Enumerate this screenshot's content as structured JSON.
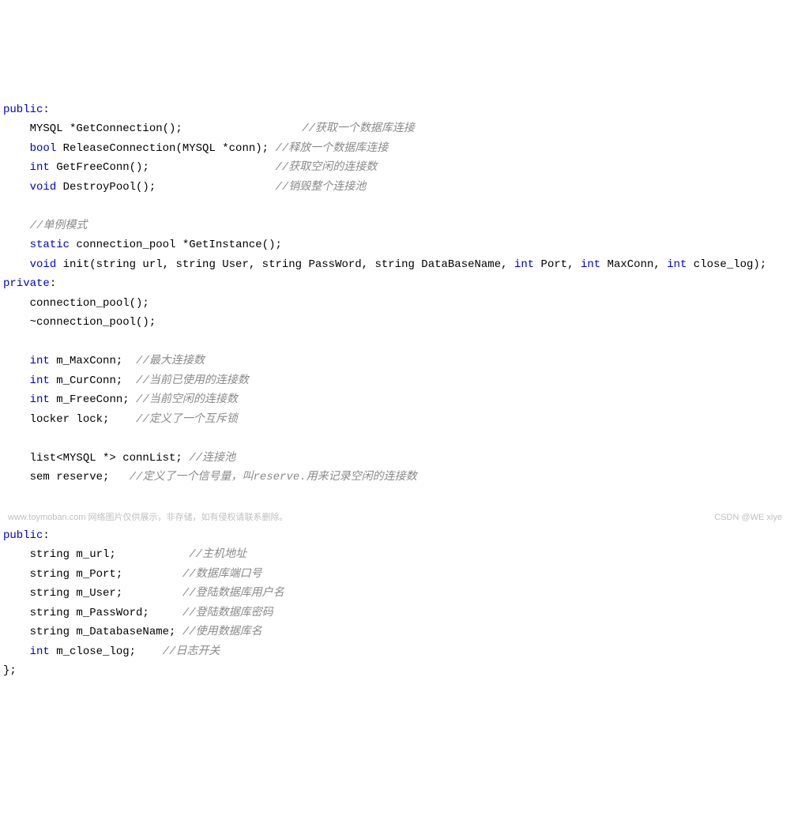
{
  "code": {
    "l1": {
      "kw": "public",
      "rest": ":"
    },
    "l2": {
      "indent": "    MYSQL *GetConnection();                  ",
      "comment": "//获取一个数据库连接"
    },
    "l3": {
      "indent": "    ",
      "kw": "bool",
      "rest": " ReleaseConnection(MYSQL *conn); ",
      "comment": "//释放一个数据库连接"
    },
    "l4": {
      "indent": "    ",
      "kw": "int",
      "rest": " GetFreeConn();                   ",
      "comment": "//获取空闲的连接数"
    },
    "l5": {
      "indent": "    ",
      "kw": "void",
      "rest": " DestroyPool();                  ",
      "comment": "//销毁整个连接池"
    },
    "blank1": "",
    "l6": {
      "indent": "    ",
      "comment": "//单例模式"
    },
    "l7": {
      "indent": "    ",
      "kw": "static",
      "rest": " connection_pool *GetInstance();"
    },
    "l8": {
      "indent": "    ",
      "kw1": "void",
      "mid": " init(string url, string User, string PassWord, string DataBaseName, ",
      "kw2": "int",
      "mid2": " Port, ",
      "kw3": "int",
      "mid3": " MaxConn, ",
      "kw4": "int",
      "rest": " close_log);"
    },
    "l9": {
      "kw": "private",
      "rest": ":"
    },
    "l10": {
      "indent": "    connection_pool();"
    },
    "l11": {
      "indent": "    ~connection_pool();"
    },
    "blank2": "",
    "l12": {
      "indent": "    ",
      "kw": "int",
      "rest": " m_MaxConn;  ",
      "comment": "//最大连接数"
    },
    "l13": {
      "indent": "    ",
      "kw": "int",
      "rest": " m_CurConn;  ",
      "comment": "//当前已使用的连接数"
    },
    "l14": {
      "indent": "    ",
      "kw": "int",
      "rest": " m_FreeConn; ",
      "comment": "//当前空闲的连接数"
    },
    "l15": {
      "indent": "    locker lock;    ",
      "comment": "//定义了一个互斥锁"
    },
    "blank3": "",
    "l16": {
      "indent": "    list<MYSQL *> connList; ",
      "comment": "//连接池"
    },
    "l17": {
      "indent": "    sem reserve;   ",
      "comment": "//定义了一个信号量，叫reserve.用来记录空闲的连接数"
    },
    "blank4": "",
    "blank5": "",
    "l18": {
      "kw": "public",
      "rest": ":"
    },
    "l19": {
      "indent": "    string m_url;           ",
      "comment": "//主机地址"
    },
    "l20": {
      "indent": "    string m_Port;         ",
      "comment": "//数据库端口号"
    },
    "l21": {
      "indent": "    string m_User;         ",
      "comment": "//登陆数据库用户名"
    },
    "l22": {
      "indent": "    string m_PassWord;     ",
      "comment": "//登陆数据库密码"
    },
    "l23": {
      "indent": "    string m_DatabaseName; ",
      "comment": "//使用数据库名"
    },
    "l24": {
      "indent": "    ",
      "kw": "int",
      "rest": " m_close_log;    ",
      "comment": "//日志开关"
    },
    "l25": {
      "text": "};"
    }
  },
  "watermarks": {
    "left": "www.toymoban.com 网络图片仅供展示，非存储，如有侵权请联系删除。",
    "right": "CSDN @WE xiye"
  }
}
